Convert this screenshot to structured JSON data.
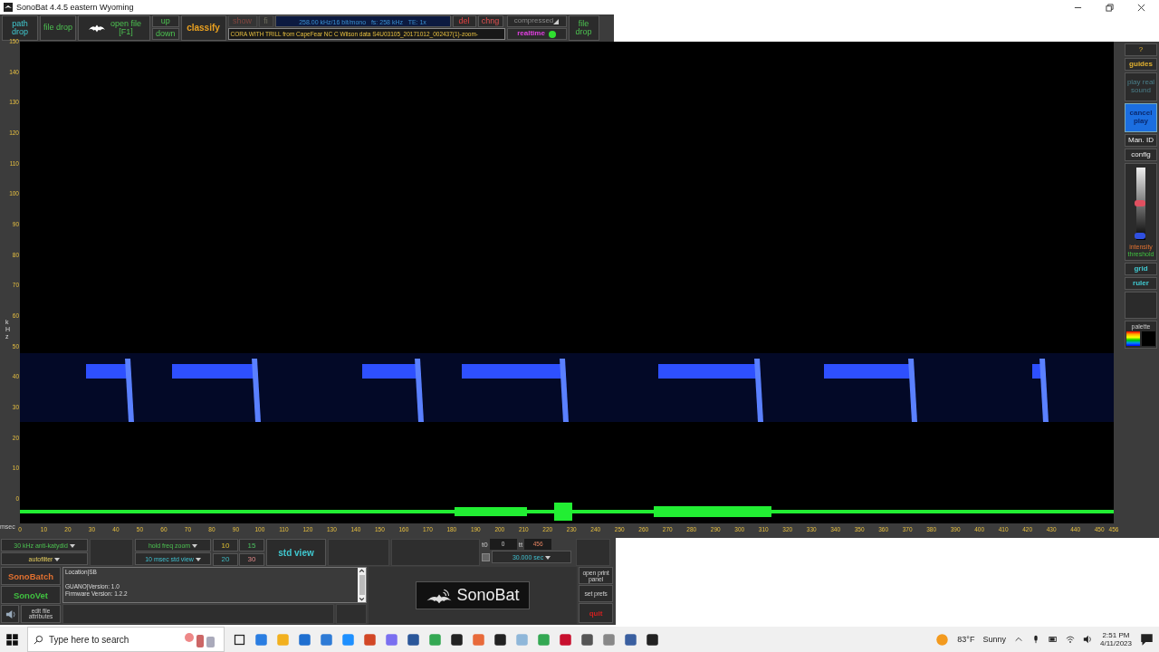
{
  "window": {
    "title": "SonoBat 4.4.5 eastern Wyoming"
  },
  "toolbar": {
    "path_drop": {
      "label": "path drop"
    },
    "file_drop": {
      "label": "file drop"
    },
    "open_file": {
      "label": "open file",
      "shortcut": "[F1]"
    },
    "up": "up",
    "down": "down",
    "classify": "classify",
    "show": {
      "label": "show",
      "disabled": true
    },
    "fi": {
      "label": "fi",
      "disabled": true
    },
    "info": "258.00 kHz/16 bit/mono   fs: 258 kHz   TE: 1x",
    "file_label": "CORA WITH TRILL from CapeFear NC C Wilson data S4U03105_20171012_002437(1)-zoom-",
    "del": "del",
    "chng": "chng",
    "compression": "compressed",
    "realtime": {
      "label": "realtime",
      "on": true
    },
    "file_drop_right": "file drop"
  },
  "spectrogram": {
    "y_label": "kHz",
    "x_label": "msec",
    "y_ticks": [
      "150",
      "140",
      "130",
      "120",
      "110",
      "100",
      "90",
      "80",
      "70",
      "60",
      "50",
      "40",
      "30",
      "20",
      "10",
      "0"
    ],
    "x_ticks": [
      "0",
      "10",
      "20",
      "30",
      "40",
      "50",
      "60",
      "70",
      "80",
      "90",
      "100",
      "110",
      "120",
      "130",
      "140",
      "150",
      "160",
      "170",
      "180",
      "190",
      "200",
      "210",
      "220",
      "230",
      "240",
      "250",
      "260",
      "270",
      "280",
      "290",
      "300",
      "310",
      "320",
      "330",
      "340",
      "350",
      "360",
      "370",
      "380",
      "390",
      "400",
      "410",
      "420",
      "430",
      "440",
      "450",
      "456"
    ]
  },
  "side_panel": {
    "help": "?",
    "guides": "guides",
    "play_real_sound": {
      "label": "play real sound",
      "disabled": true
    },
    "cancel_play": {
      "label": "cancel play",
      "active": true
    },
    "manual_id": "Man. ID",
    "config": "config",
    "intensity": {
      "label": "intensity",
      "level": 0.5
    },
    "threshold": {
      "label": "threshold",
      "level": 0.05
    },
    "grid": "grid",
    "ruler": "ruler",
    "palette": "palette"
  },
  "bottom": {
    "filter": "30 kHz anti-katydid",
    "autofilter": "autofilter",
    "zoom_mode": "hold freq zoom",
    "view": "10 msec std view",
    "presets": [
      "10",
      "15",
      "20",
      "30"
    ],
    "std_view": "std view",
    "t0": {
      "label": "t0",
      "value": "0"
    },
    "tt": {
      "label": "tt",
      "value": "456"
    },
    "checkbox": {
      "checked": false
    },
    "duration": "30.000 sec",
    "sonobatch": "SonoBatch",
    "sonovet": "SonoVet",
    "edit": "edit file attributes",
    "metadata": [
      "Location|SB",
      "GUANO|Version:  1.0",
      "Firmware Version:  1.2.2"
    ],
    "logo": "SonoBat",
    "print": "open print panel",
    "prefs": "set prefs",
    "quit": "quit"
  },
  "taskbar": {
    "search_placeholder": "Type here to search",
    "weather": {
      "temp": "83°F",
      "condition": "Sunny"
    },
    "time": "2:51 PM",
    "date": "4/11/2023"
  }
}
